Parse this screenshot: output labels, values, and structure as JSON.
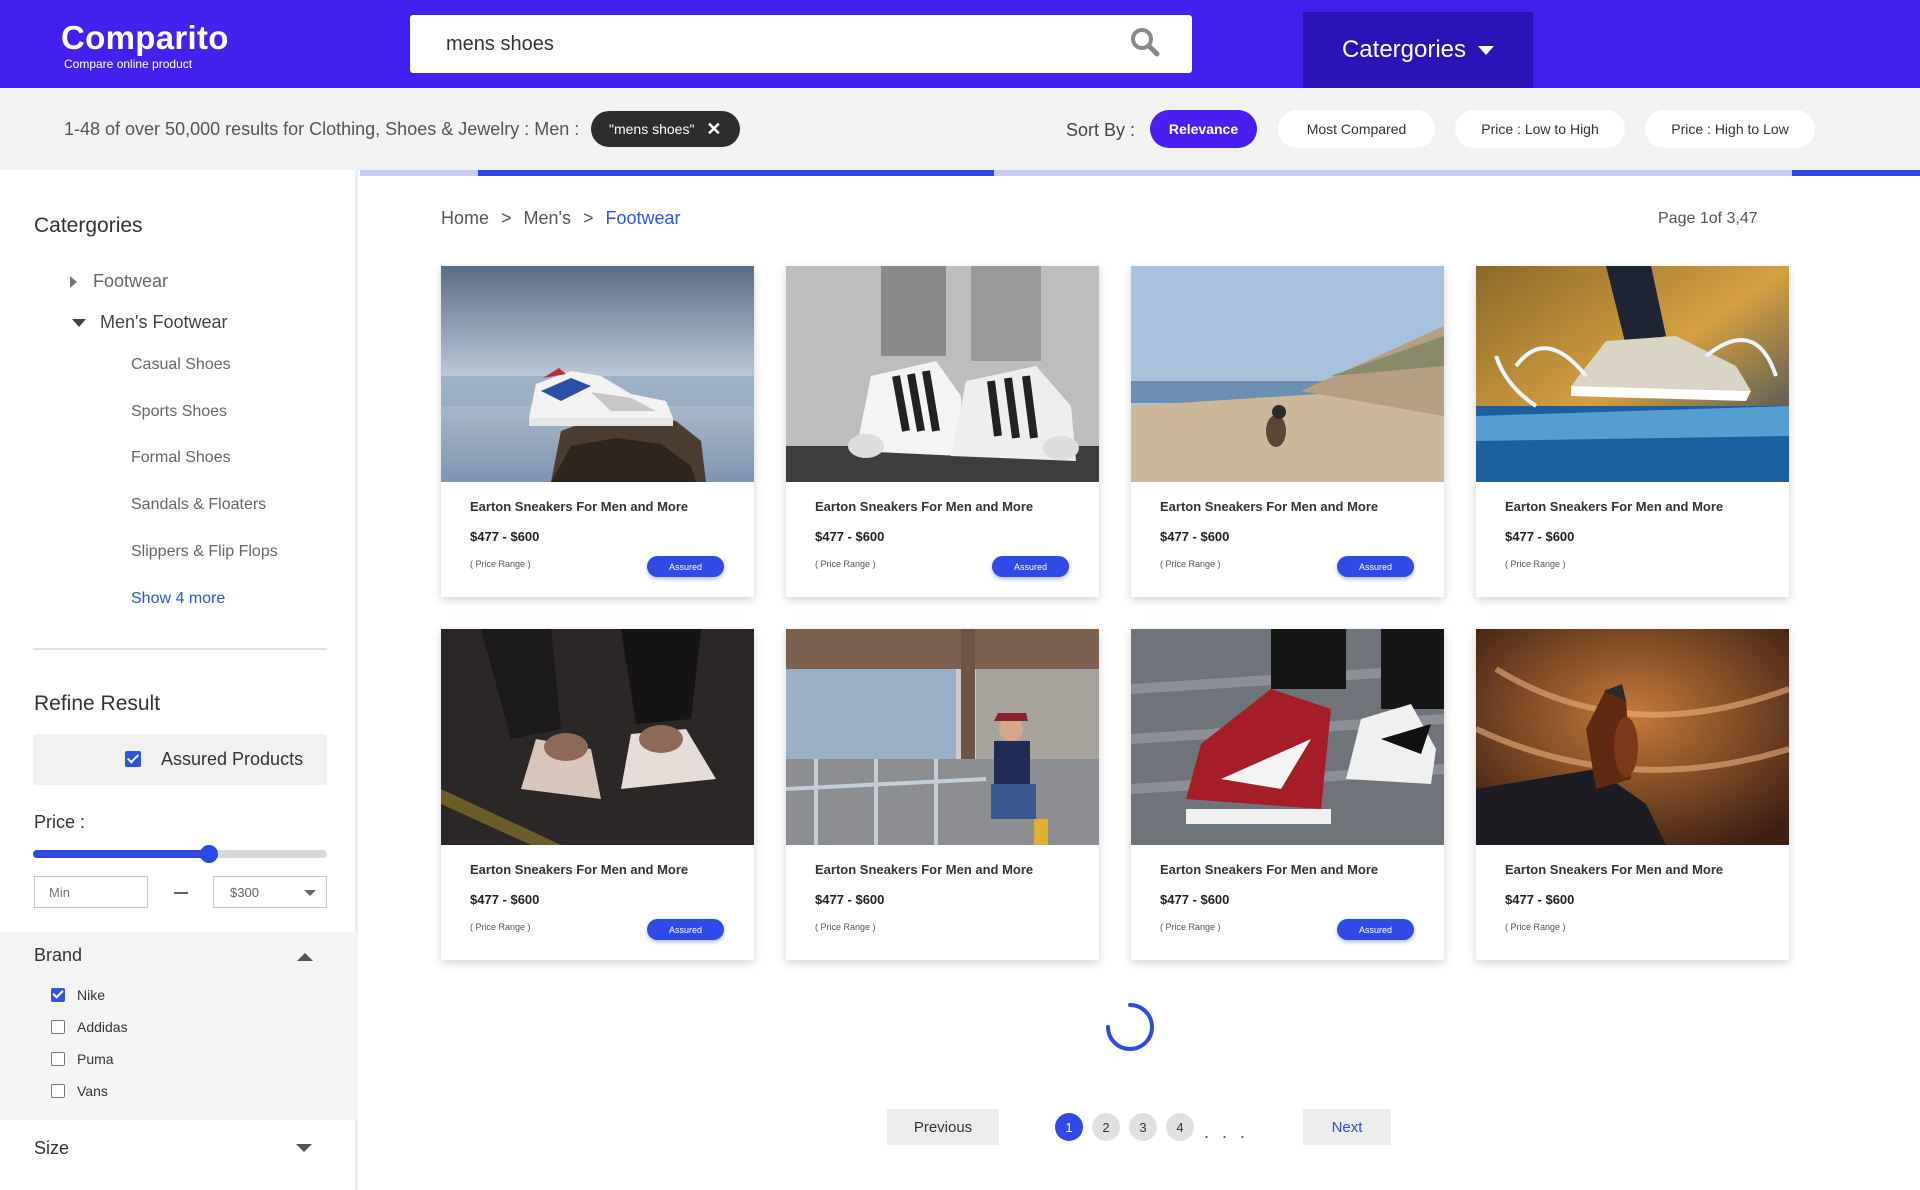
{
  "header": {
    "logo_title": "Comparito",
    "logo_subtitle": "Compare online product",
    "search_value": "mens shoes",
    "categories_label": "Catergories"
  },
  "subbar": {
    "results_text": "1-48 of over 50,000 results for Clothing, Shoes & Jewelry : Men :",
    "active_tag": "\"mens shoes\"",
    "tag_close": "✕",
    "sort_label": "Sort By :",
    "sort_options": [
      {
        "label": "Relevance",
        "active": true
      },
      {
        "label": "Most Compared",
        "active": false
      },
      {
        "label": "Price : Low to High",
        "active": false
      },
      {
        "label": "Price : High to Low",
        "active": false
      }
    ]
  },
  "sidebar": {
    "categories_heading": "Catergories",
    "tree": [
      {
        "label": "Footwear",
        "expanded": false
      },
      {
        "label": "Men's Footwear",
        "expanded": true
      }
    ],
    "sub_items": [
      "Casual Shoes",
      "Sports Shoes",
      "Formal Shoes",
      "Sandals & Floaters",
      "Slippers & Flip Flops"
    ],
    "show_more": "Show 4 more",
    "refine_heading": "Refine Result",
    "assured_label": "Assured Products",
    "price_label": "Price :",
    "price_slider_fraction": 0.6,
    "min_placeholder": "Min",
    "max_value": "$300",
    "brand_heading": "Brand",
    "brands": [
      {
        "label": "Nike",
        "checked": true
      },
      {
        "label": "Addidas",
        "checked": false
      },
      {
        "label": "Puma",
        "checked": false
      },
      {
        "label": "Vans",
        "checked": false
      }
    ],
    "size_heading": "Size"
  },
  "main": {
    "breadcrumb": [
      "Home",
      ">",
      "Men's",
      ">",
      "Footwear"
    ],
    "page_info": "Page 1of 3,47",
    "products": [
      {
        "title": "Earton Sneakers For Men and More",
        "price": "$477 - $600",
        "range": "( Price Range )",
        "assured": true,
        "badge": "Assured",
        "image": "sneaker-on-rock"
      },
      {
        "title": "Earton Sneakers For Men and More",
        "price": "$477 - $600",
        "range": "( Price Range )",
        "assured": true,
        "badge": "Assured",
        "image": "black-white-sneakers"
      },
      {
        "title": "Earton Sneakers For Men and More",
        "price": "$477 - $600",
        "range": "( Price Range )",
        "assured": true,
        "badge": "Assured",
        "image": "beach-dog"
      },
      {
        "title": "Earton Sneakers For Men and More",
        "price": "$477 - $600",
        "range": "( Price Range )",
        "assured": false,
        "badge": "",
        "image": "splash-sneaker"
      },
      {
        "title": "Earton Sneakers For Men and More",
        "price": "$477 - $600",
        "range": "( Price Range )",
        "assured": true,
        "badge": "Assured",
        "image": "tying-shoes"
      },
      {
        "title": "Earton Sneakers For Men and More",
        "price": "$477 - $600",
        "range": "( Price Range )",
        "assured": false,
        "badge": "",
        "image": "man-on-railing"
      },
      {
        "title": "Earton Sneakers For Men and More",
        "price": "$477 - $600",
        "range": "( Price Range )",
        "assured": true,
        "badge": "Assured",
        "image": "red-high-tops"
      },
      {
        "title": "Earton Sneakers For Men and More",
        "price": "$477 - $600",
        "range": "( Price Range )",
        "assured": false,
        "badge": "",
        "image": "brown-dress-shoe"
      }
    ],
    "pagination": {
      "previous": "Previous",
      "next": "Next",
      "pages": [
        "1",
        "2",
        "3",
        "4"
      ],
      "current": "1",
      "ellipsis": ". . ."
    }
  },
  "colors": {
    "brand": "#4420ee",
    "brand_dark": "#2a14b8",
    "accent": "#2f4ae6",
    "subbar_bg": "#f2f2f2"
  },
  "icons": {
    "search": "search-icon",
    "categories_caret": "chevron-down-icon",
    "tag_close": "close-icon",
    "tree_collapsed": "caret-right-icon",
    "tree_expanded": "caret-down-icon",
    "brand_collapse": "caret-up-icon",
    "size_expand": "caret-down-icon",
    "loading": "spinner-icon"
  }
}
